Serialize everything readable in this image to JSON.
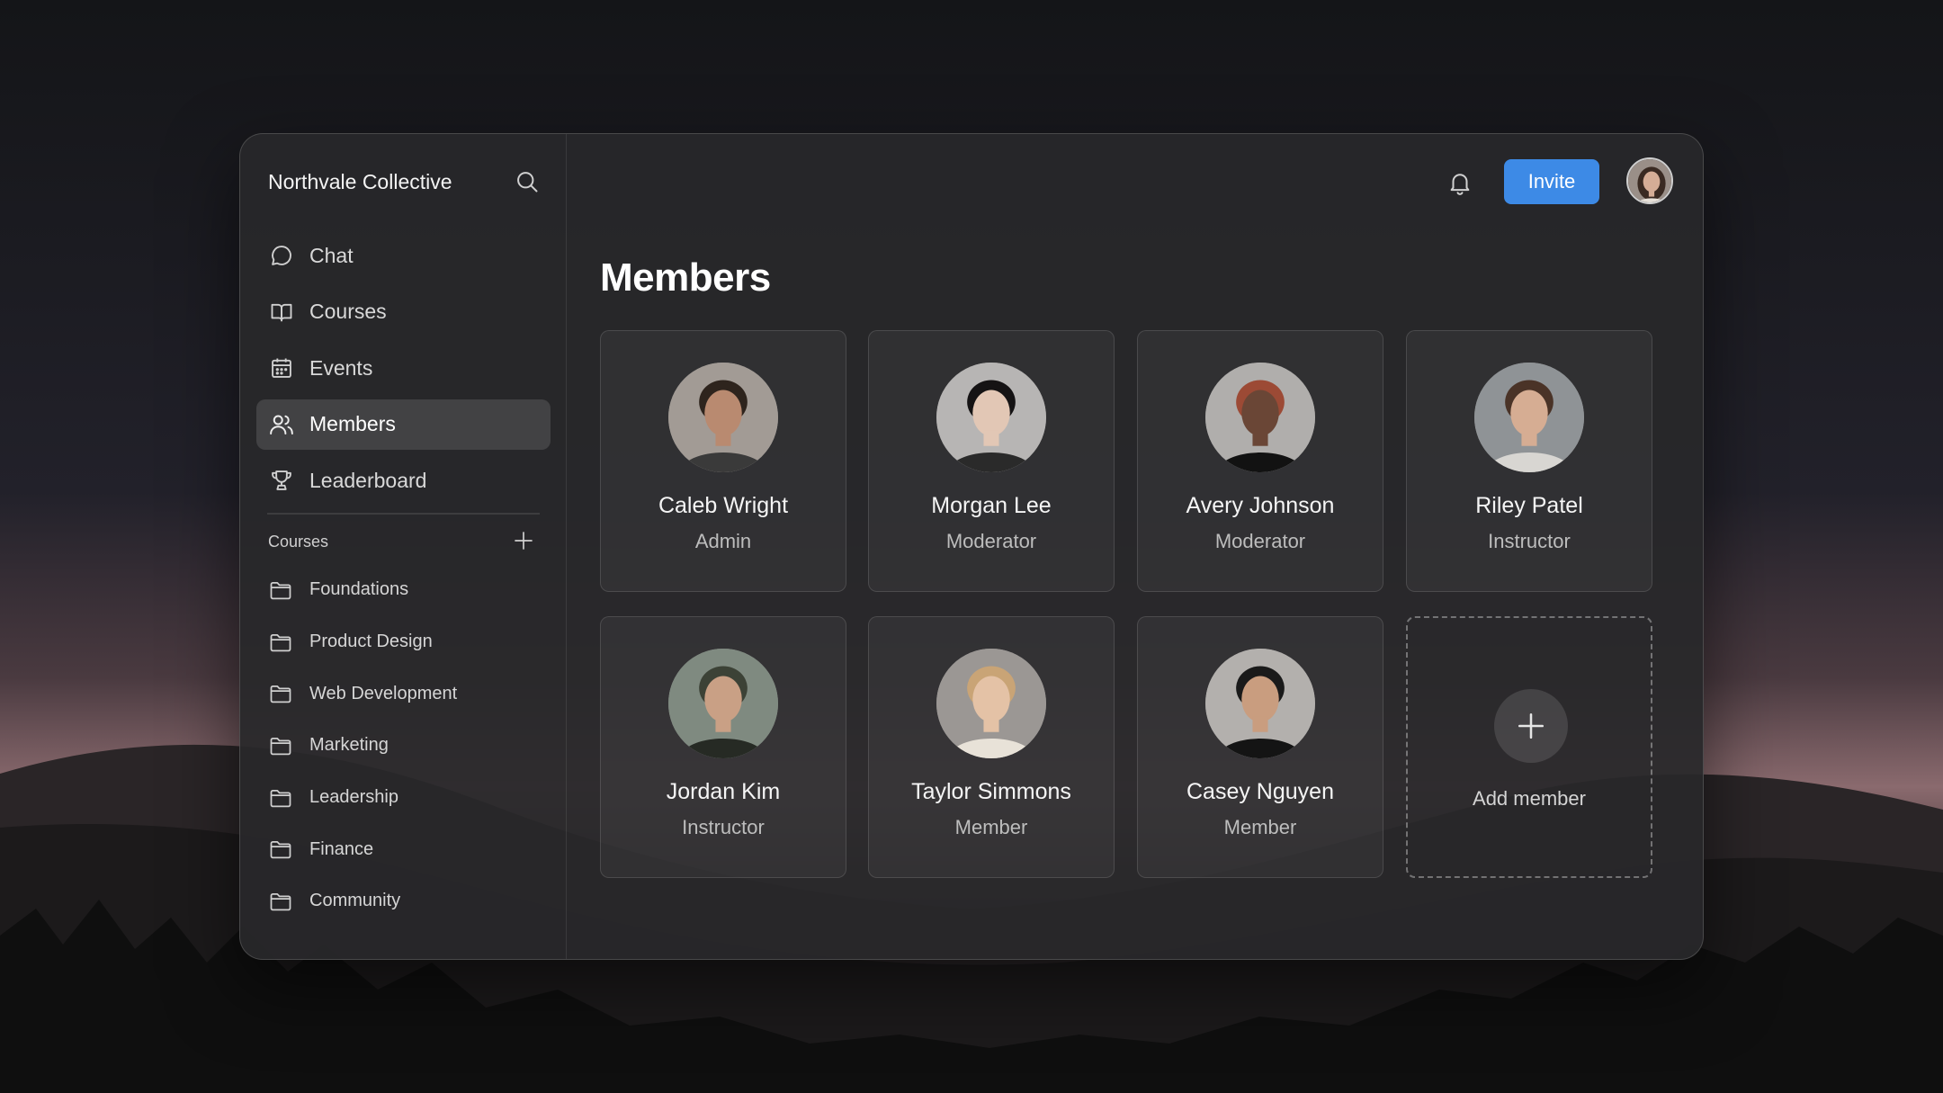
{
  "app": {
    "brand": "Northvale Collective"
  },
  "nav": {
    "items": [
      {
        "label": "Chat",
        "icon": "chat-bubble-icon",
        "active": false
      },
      {
        "label": "Courses",
        "icon": "book-icon",
        "active": false
      },
      {
        "label": "Events",
        "icon": "calendar-icon",
        "active": false
      },
      {
        "label": "Members",
        "icon": "users-icon",
        "active": true
      },
      {
        "label": "Leaderboard",
        "icon": "trophy-icon",
        "active": false
      }
    ]
  },
  "courses": {
    "title": "Courses",
    "items": [
      {
        "label": "Foundations"
      },
      {
        "label": "Product Design"
      },
      {
        "label": "Web Development"
      },
      {
        "label": "Marketing"
      },
      {
        "label": "Leadership"
      },
      {
        "label": "Finance"
      },
      {
        "label": "Community"
      }
    ]
  },
  "header": {
    "invite_label": "Invite"
  },
  "main": {
    "title": "Members",
    "members": [
      {
        "name": "Caleb Wright",
        "role": "Admin",
        "skin": "#b98a70",
        "hair": "#2e241d",
        "shirt": "#3a3a3a",
        "bg": "#a29b95"
      },
      {
        "name": "Morgan Lee",
        "role": "Moderator",
        "skin": "#e2c7b5",
        "hair": "#151314",
        "shirt": "#2a2a2a",
        "bg": "#b7b5b4"
      },
      {
        "name": "Avery Johnson",
        "role": "Moderator",
        "skin": "#6a4636",
        "hair": "#9c4a35",
        "shirt": "#121212",
        "bg": "#b0aeac"
      },
      {
        "name": "Riley Patel",
        "role": "Instructor",
        "skin": "#d6ad93",
        "hair": "#4a3327",
        "shirt": "#d8d6d2",
        "bg": "#8f9396"
      },
      {
        "name": "Jordan Kim",
        "role": "Instructor",
        "skin": "#c9a085",
        "hair": "#3c4236",
        "shirt": "#262a24",
        "bg": "#7f8a80"
      },
      {
        "name": "Taylor Simmons",
        "role": "Member",
        "skin": "#e4c2a6",
        "hair": "#c9a476",
        "shirt": "#e8e2d8",
        "bg": "#9b9794"
      },
      {
        "name": "Casey Nguyen",
        "role": "Member",
        "skin": "#c99d7f",
        "hair": "#1a1a1a",
        "shirt": "#141414",
        "bg": "#b3b0ad"
      }
    ],
    "add_member_label": "Add member"
  },
  "colors": {
    "accent": "#3d8ae6",
    "window_bg": "#28282a",
    "active_nav_bg": "#3c3c3e"
  }
}
